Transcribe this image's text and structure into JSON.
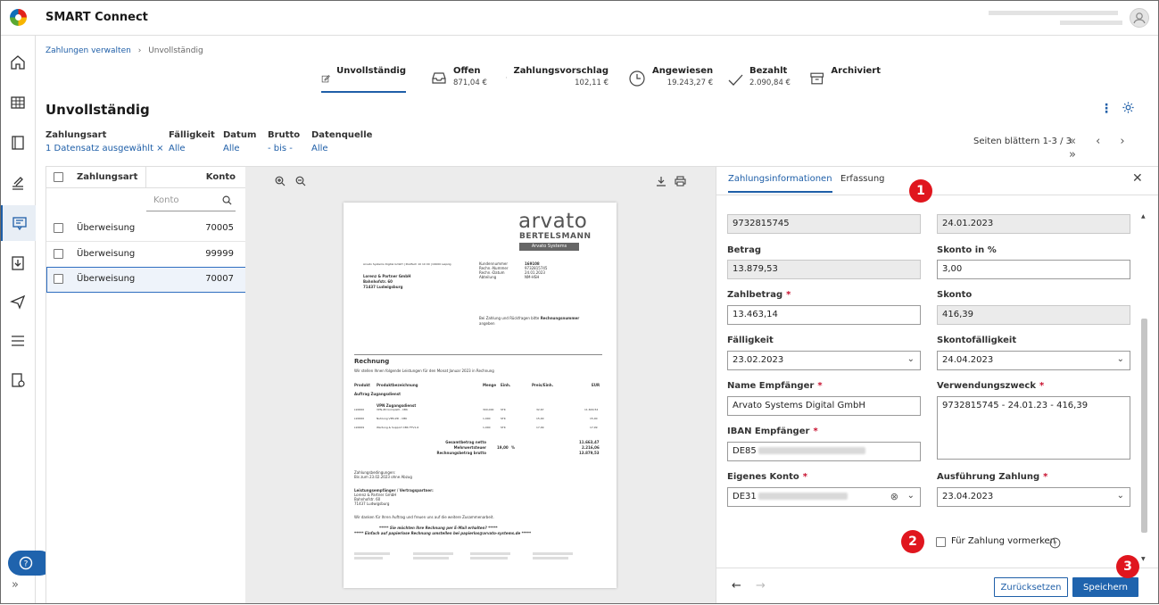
{
  "app": {
    "title": "SMART Connect",
    "help_icon": "question-circle-icon"
  },
  "breadcrumb": {
    "parent": "Zahlungen verwalten",
    "separator": "›",
    "current": "Unvollständig"
  },
  "status_tabs": [
    {
      "label": "Unvollständig",
      "value": "",
      "icon": "edit-icon"
    },
    {
      "label": "Offen",
      "value": "871,04 €",
      "icon": "inbox-icon"
    },
    {
      "label": "Zahlungsvorschlag",
      "value": "102,11 €",
      "icon": "payment-proposal-icon"
    },
    {
      "label": "Angewiesen",
      "value": "19.243,27 €",
      "icon": "clock-icon"
    },
    {
      "label": "Bezahlt",
      "value": "2.090,84 €",
      "icon": "check-icon"
    },
    {
      "label": "Archiviert",
      "value": "",
      "icon": "archive-icon"
    }
  ],
  "page": {
    "title": "Unvollständig"
  },
  "filters": [
    {
      "label": "Zahlungsart",
      "value": "1 Datensatz ausgewählt ×"
    },
    {
      "label": "Fälligkeit",
      "value": "Alle"
    },
    {
      "label": "Datum",
      "value": "Alle"
    },
    {
      "label": "Brutto",
      "value": "- bis -"
    },
    {
      "label": "Datenquelle",
      "value": "Alle"
    }
  ],
  "pager": {
    "text": "Seiten blättern 1-3 / 3",
    "icons": "« ‹ › »"
  },
  "table": {
    "headers": {
      "type": "Zahlungsart",
      "account": "Konto"
    },
    "filter_placeholder": "Konto",
    "rows": [
      {
        "type": "Überweisung",
        "account": "70005",
        "selected": false
      },
      {
        "type": "Überweisung",
        "account": "99999",
        "selected": false
      },
      {
        "type": "Überweisung",
        "account": "70007",
        "selected": true
      }
    ]
  },
  "document": {
    "logo_main": "arvato",
    "logo_sub": "BERTELSMANN",
    "logo_tag": "Arvato Systems",
    "sender_line": "Arvato Systems Digital GmbH | Postfach 10 10 00 | 04000 Leipzig",
    "recipient": [
      "Lorenz & Partner GmbH",
      "Bahnhofstr. 60",
      "71437 Ludwigsburg"
    ],
    "meta_labels": [
      "Kundennummer",
      "Rechn.-Nummer",
      "Rechn.-Datum",
      "Abteilung"
    ],
    "meta_values": [
      "169108",
      "9732815745",
      "24.01.2023",
      "NM-HSH"
    ],
    "note": "Bei Zahlung und Rückfragen bitte",
    "note_bold": "Rechnungsnummer",
    "note_end": "angeben",
    "heading": "Rechnung",
    "intro": "Wir stellen Ihnen folgende Leistungen für den Monat Januar 2023 in Rechnung",
    "cols": [
      "Produkt",
      "Produktbezeichnung",
      "Menge",
      "Einh.",
      "Preis/Einh.",
      "EUR"
    ],
    "section": "Auftrag Zugangsdienst",
    "group": "VPN Zugangsdienst",
    "lines": [
      [
        "L90000",
        "VPN-ZD komplett - CBK",
        "300,000",
        "STK",
        "32,67",
        "11.600,52"
      ],
      [
        "L90000",
        "Nutzung VPN-ZD - CBK",
        "1,000",
        "STK",
        "15,00",
        "15,00"
      ],
      [
        "L90009",
        "Wartung & Support CBK FTV1-6",
        "1,000",
        "STK",
        "17,99",
        "17,99"
      ]
    ],
    "totals_labels": [
      "Gesamtbetrag netto",
      "Mehrwertsteuer",
      "Rechnungsbetrag brutto"
    ],
    "totals_values": [
      "11.663,47",
      "2.216,06",
      "13.879,53"
    ],
    "vat_rate": "19,00",
    "vat_unit": "%",
    "terms_label": "Zahlungsbedingungen:",
    "terms": "Bis zum 23.02.2023 ohne Abzug",
    "recv_label": "Leistungsempfänger / Vertragspartner:",
    "recv": [
      "Lorenz & Partner GmbH",
      "Bahnhofstr. 60",
      "71437 Ludwigsburg"
    ],
    "thanks": "Wir danken für Ihren Auftrag und freuen uns auf die weitere Zusammenarbeit.",
    "promo1": "*****          Sie möchten Ihre Rechnung per E-Mail erhalten?          *****",
    "promo2": "*****   Einfach auf papierlose Rechnung umstellen bei papierlos@arvato-systems.de   *****"
  },
  "viewer_icons": [
    "zoom-in-icon",
    "zoom-out-icon",
    "download-icon",
    "print-icon"
  ],
  "detail": {
    "tabs": [
      "Zahlungsinformationen",
      "Erfassung"
    ],
    "fields": {
      "invoice_number": {
        "value": "9732815745"
      },
      "invoice_date": {
        "value": "24.01.2023"
      },
      "betrag": {
        "label": "Betrag",
        "value": "13.879,53"
      },
      "skonto_pct": {
        "label": "Skonto in %",
        "value": "3,00"
      },
      "zahlbetrag": {
        "label": "Zahlbetrag",
        "value": "13.463,14"
      },
      "skonto": {
        "label": "Skonto",
        "value": "416,39"
      },
      "faelligkeit": {
        "label": "Fälligkeit",
        "value": "23.02.2023"
      },
      "skontofaelligkeit": {
        "label": "Skontofälligkeit",
        "value": "24.04.2023"
      },
      "empfaenger": {
        "label": "Name Empfänger",
        "value": "Arvato Systems Digital GmbH"
      },
      "verwendungszweck": {
        "label": "Verwendungszweck",
        "value": "9732815745 - 24.01.23 - 416,39"
      },
      "iban": {
        "label": "IBAN Empfänger",
        "value": "DE85"
      },
      "eigenes_konto": {
        "label": "Eigenes Konto",
        "value": "DE31"
      },
      "ausfuehrung": {
        "label": "Ausführung Zahlung",
        "value": "23.04.2023"
      }
    },
    "required_mark": "*",
    "checkbox_label": "Für Zahlung vormerken",
    "buttons": {
      "reset": "Zurücksetzen",
      "save": "Speichern"
    }
  },
  "markers": [
    "1",
    "2",
    "3"
  ],
  "colors": {
    "accent": "#1f63ad",
    "marker": "#e0161e",
    "required": "#c8102e"
  }
}
